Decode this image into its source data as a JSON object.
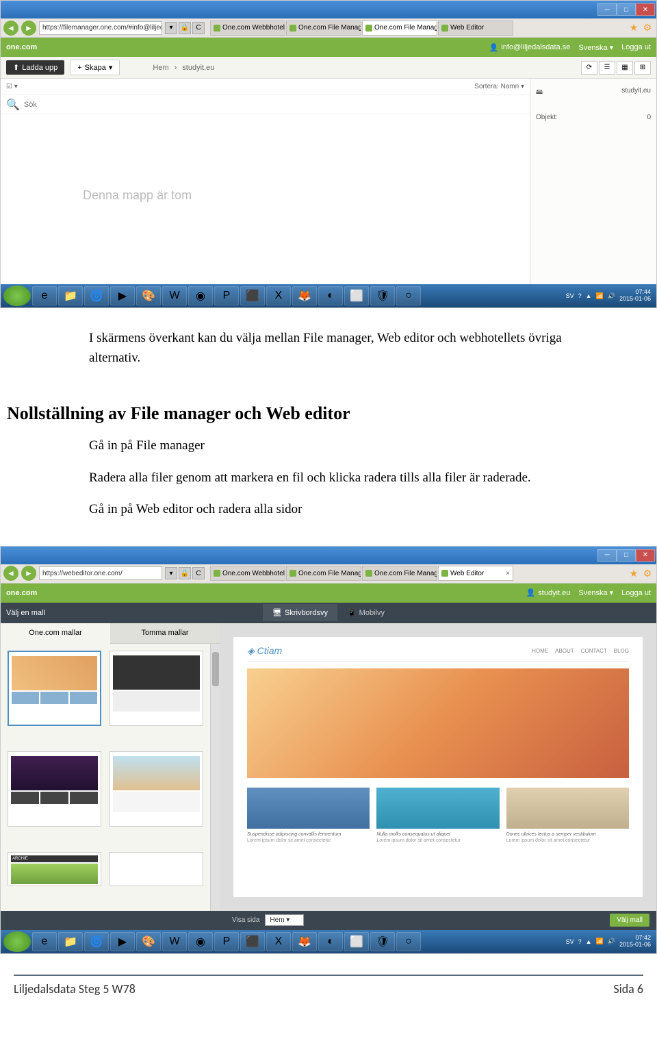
{
  "screenshot1": {
    "url": "https://filemanager.one.com/#info@liljedalsd",
    "tabs": [
      {
        "label": "One.com Webbhotell - Domä...",
        "active": false
      },
      {
        "label": "One.com File Manager",
        "active": false
      },
      {
        "label": "One.com File Manager",
        "active": true
      },
      {
        "label": "Web Editor",
        "active": false
      }
    ],
    "brand": "one.com",
    "user": "info@liljedalsdata.se",
    "lang": "Svenska",
    "logout": "Logga ut",
    "upload": "Ladda upp",
    "create": "Skapa",
    "breadcrumb": [
      "Hem",
      "studyit.eu"
    ],
    "sort_label": "Sortera: Namn",
    "search_placeholder": "Sök",
    "empty_msg": "Denna mapp är tom",
    "side_title": "studyit.eu",
    "side_objects_label": "Objekt:",
    "side_objects_count": "0",
    "taskbar_lang": "SV",
    "taskbar_time": "07:44",
    "taskbar_date": "2015-01-06"
  },
  "doc": {
    "para1": "I skärmens överkant kan du välja mellan File manager, Web editor och webhotellets övriga alternativ.",
    "heading": "Nollställning av File manager och Web editor",
    "para2": "Gå in på File manager",
    "para3": "Radera alla filer genom att markera en fil och klicka radera tills alla filer är raderade.",
    "para4": "Gå in på Web editor och radera alla sidor"
  },
  "screenshot2": {
    "url": "https://webeditor.one.com/",
    "tabs": [
      {
        "label": "One.com Webbhotell - Domä...",
        "active": false
      },
      {
        "label": "One.com File Manager",
        "active": false
      },
      {
        "label": "One.com File Manager",
        "active": false
      },
      {
        "label": "Web Editor",
        "active": true
      }
    ],
    "brand": "one.com",
    "user": "studyit.eu",
    "lang": "Svenska",
    "logout": "Logga ut",
    "choose_template": "Välj en mall",
    "view_desktop": "Skrivbordsvy",
    "view_mobile": "Mobilvy",
    "tab_onecom": "One.com mallar",
    "tab_empty": "Tomma mallar",
    "preview_logo": "Ctiam",
    "preview_nav": [
      "HOME",
      "ABOUT",
      "CONTACT",
      "BLOG"
    ],
    "card1_h": "Suspendisse adipiscing convallis fermentum",
    "card1_t": "Lorem ipsum dolor sit amet consectetur",
    "card2_h": "Nulla mollis consequatus ut aliquet",
    "card2_t": "Lorem ipsum dolor sit amet consectetur",
    "card3_h": "Donec ultrices lectus a semper vestibulum",
    "card3_t": "Lorem ipsum dolor sit amet consectetur",
    "bottom_show": "Visa sida",
    "bottom_page": "Hem",
    "bottom_btn": "Välj mall",
    "taskbar_lang": "SV",
    "taskbar_time": "07:42",
    "taskbar_date": "2015-01-06"
  },
  "footer": {
    "left": "Liljedalsdata Steg 5 W78",
    "right": "Sida 6"
  }
}
